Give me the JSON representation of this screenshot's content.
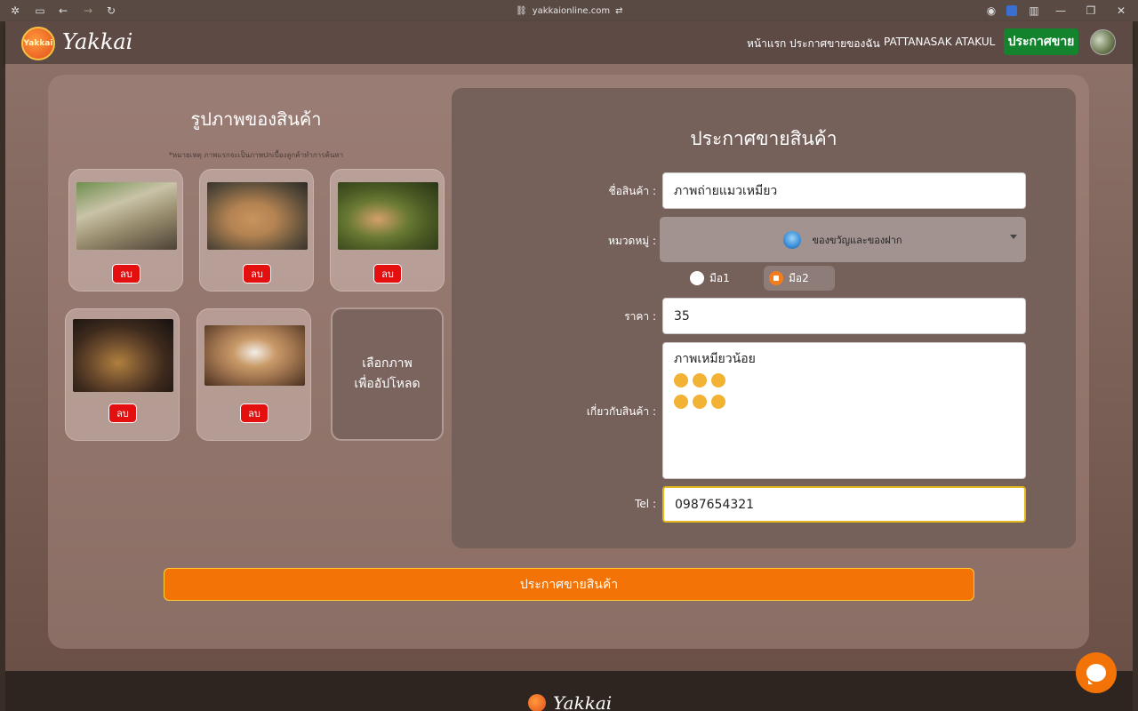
{
  "browser": {
    "url": "yakkaionline.com"
  },
  "navbar": {
    "logo_badge": "Yakkai",
    "logo_text": "Yakkai",
    "links": [
      "หน้าแรก",
      "ประกาศขายของฉัน",
      "PATTANASAK ATAKUL"
    ],
    "cta": "ประกาศขาย"
  },
  "images_section": {
    "title": "รูปภาพของสินค้า",
    "note": "*หมายเหตุ ภาพแรกจะเป็นภาพปกเบื้องลูกค้าทำการค้นหา",
    "delete_label": "ลบ",
    "upload_line1": "เลือกภาพ",
    "upload_line2": "เพื่ออัปโหลด",
    "thumbnail_colors": [
      "#9b8f70",
      "#b48352",
      "#4a5a24",
      "#3d2a1d",
      "#a27650"
    ]
  },
  "form": {
    "title": "ประกาศขายสินค้า",
    "name_label": "ชื่อสินค้า :",
    "name_value": "ภาพถ่ายแมวเหมียว",
    "category_label": "หมวดหมู่ :",
    "category_value": "ของขวัญและของฝาก",
    "condition_options": [
      "มือ1",
      "มือ2"
    ],
    "condition_selected": "มือ2",
    "price_label": "ราคา :",
    "price_value": "35",
    "about_label": "เกี่ยวกับสินค้า :",
    "about_text": "ภาพเหมียวน้อย",
    "tel_label": "Tel :",
    "tel_value": "0987654321",
    "submit_label": "ประกาศขายสินค้า"
  },
  "footer": {
    "logo_text": "Yakkai"
  },
  "colors": {
    "accent": "#f47306",
    "cta_green": "#13832d",
    "delete_red": "#e41010"
  }
}
